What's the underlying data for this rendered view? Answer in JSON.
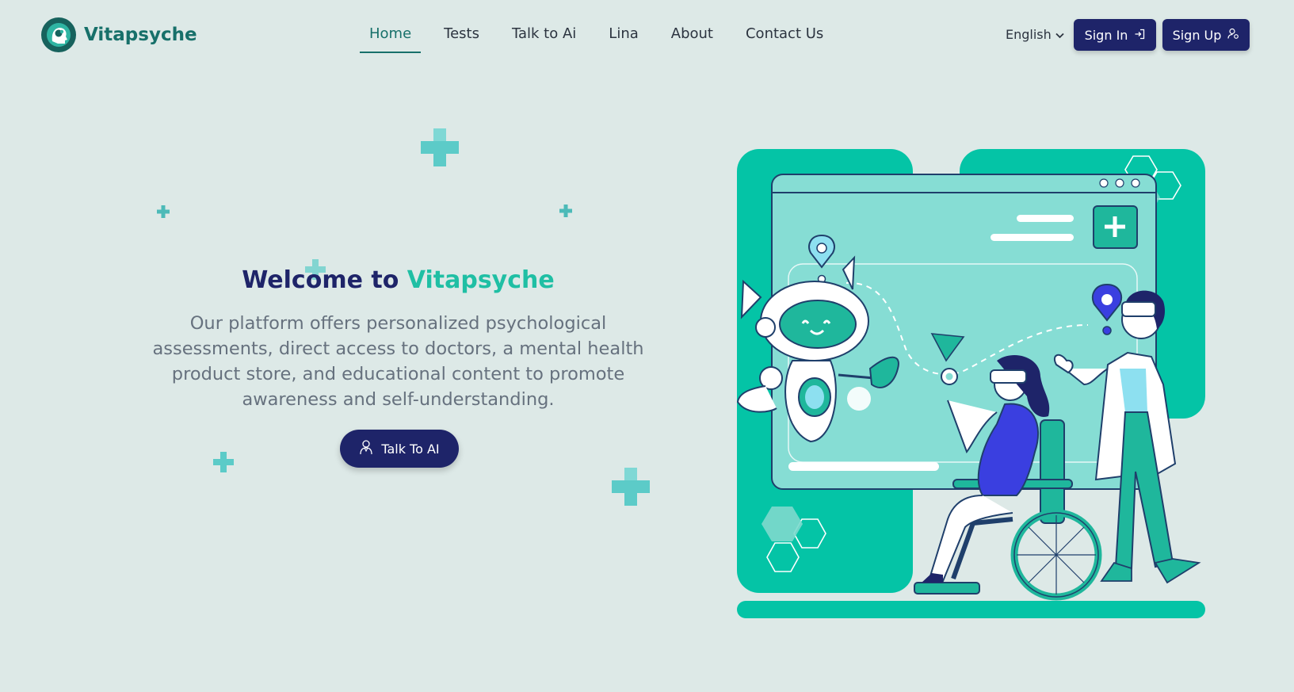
{
  "brand": {
    "name": "Vitapsyche",
    "logo_icon": "brain-head-icon"
  },
  "nav": {
    "items": [
      {
        "label": "Home",
        "active": true
      },
      {
        "label": "Tests"
      },
      {
        "label": "Talk to Ai"
      },
      {
        "label": "Lina"
      },
      {
        "label": "About"
      },
      {
        "label": "Contact Us"
      }
    ]
  },
  "language": {
    "selected": "English",
    "icon": "chevron-down-icon"
  },
  "auth": {
    "sign_in": "Sign In",
    "sign_in_icon": "sign-in-icon",
    "sign_up": "Sign Up",
    "sign_up_icon": "user-gear-icon"
  },
  "hero": {
    "title_prefix": "Welcome to ",
    "title_accent": "Vitapsyche",
    "description": "Our platform offers personalized psychological assessments, direct access to doctors, a mental health product store, and educational content to promote awareness and self-understanding.",
    "cta_label": "Talk To AI",
    "cta_icon": "ai-user-icon"
  },
  "colors": {
    "background": "#dde9e7",
    "primary": "#1e2469",
    "accent": "#1fbfa4",
    "brand_teal": "#17706a",
    "illustration_teal": "#04c4a6",
    "illustration_blue": "#3a3fe0"
  }
}
